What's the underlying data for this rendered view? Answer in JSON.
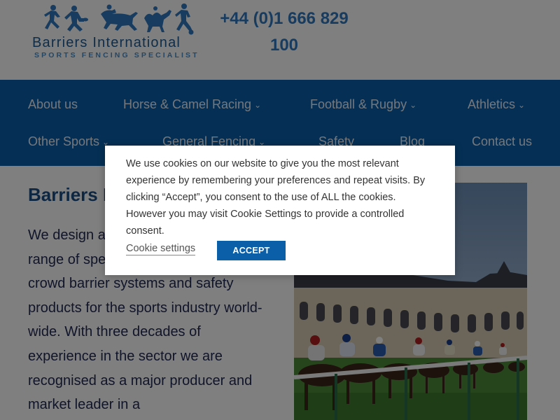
{
  "brand": {
    "name": "Barriers International",
    "tagline": "SPORTS FENCING SPECIALIST",
    "phone_line1": "+44 (0)1 666 829",
    "phone_line2": "100",
    "color_primary": "#0a5fa8",
    "color_logo": "#1f5a93"
  },
  "nav": {
    "items": [
      {
        "label": "About us",
        "has_dropdown": false
      },
      {
        "label": "Horse & Camel Racing",
        "has_dropdown": true
      },
      {
        "label": "Football & Rugby",
        "has_dropdown": true
      },
      {
        "label": "Athletics",
        "has_dropdown": true
      },
      {
        "label": "Other Sports",
        "has_dropdown": true
      },
      {
        "label": "General Fencing",
        "has_dropdown": true
      },
      {
        "label": "Safety",
        "has_dropdown": false
      },
      {
        "label": "Blog",
        "has_dropdown": false
      },
      {
        "label": "Contact us",
        "has_dropdown": false
      }
    ],
    "dropdown_icon": "chevron-down-icon"
  },
  "main": {
    "title": "Barriers International",
    "intro": "We design and manufacture a wide range of specialist sports fencing, crowd barrier systems and safety products for the sports industry world-wide. With three decades of experience in the sector we are recognised as a major producer and market leader in a",
    "hero_image": "horse-racing-photo"
  },
  "cookie": {
    "text": "We use cookies on our website to give you the most relevant experience by remembering your preferences and repeat visits. By clicking “Accept”, you consent to the use of ALL the cookies. However you may visit Cookie Settings to provide a controlled consent.",
    "settings_label": "Cookie settings",
    "accept_label": "ACCEPT"
  }
}
